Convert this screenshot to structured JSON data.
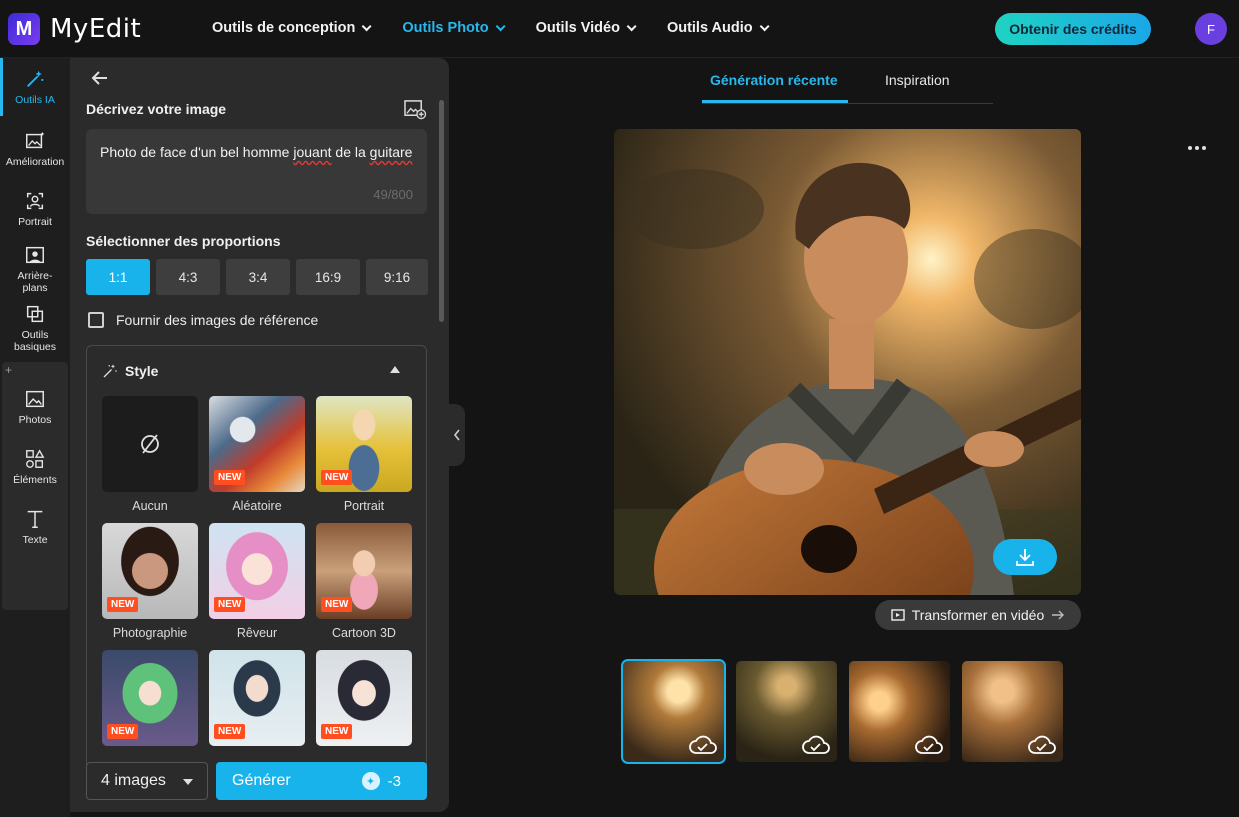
{
  "app": {
    "logo_letter": "M",
    "name": "MyEdit"
  },
  "nav": [
    {
      "label": "Outils de conception",
      "active": false
    },
    {
      "label": "Outils Photo",
      "active": true
    },
    {
      "label": "Outils Vidéo",
      "active": false
    },
    {
      "label": "Outils Audio",
      "active": false
    }
  ],
  "header": {
    "credits_button": "Obtenir des crédits",
    "avatar_initial": "F"
  },
  "rail": [
    {
      "label": "Outils IA",
      "icon": "magic-wand-icon",
      "active": true
    },
    {
      "label": "Amélioration",
      "icon": "image-enhance-icon"
    },
    {
      "label": "Portrait",
      "icon": "portrait-icon"
    },
    {
      "label": "Arrière-plans",
      "icon": "background-icon"
    },
    {
      "label": "Outils basiques",
      "icon": "crop-icon"
    },
    {
      "label": "Photos",
      "icon": "photo-icon"
    },
    {
      "label": "Éléments",
      "icon": "shapes-icon"
    },
    {
      "label": "Texte",
      "icon": "text-icon"
    }
  ],
  "panel": {
    "describe_title": "Décrivez votre image",
    "prompt_text_1": "Photo de face d'un bel homme ",
    "prompt_text_misspelled_1": "jouant",
    "prompt_text_2": " de la ",
    "prompt_text_misspelled_2": "guitare",
    "counter": "49/800",
    "ratio_title": "Sélectionner des proportions",
    "ratios": [
      "1:1",
      "4:3",
      "3:4",
      "16:9",
      "9:16"
    ],
    "selected_ratio": "1:1",
    "reference_label": "Fournir des images de référence",
    "reference_checked": false,
    "style_title": "Style",
    "styles": [
      {
        "label": "Aucun",
        "new": false
      },
      {
        "label": "Aléatoire",
        "new": true
      },
      {
        "label": "Portrait",
        "new": true
      },
      {
        "label": "Photographie",
        "new": true
      },
      {
        "label": "Rêveur",
        "new": true
      },
      {
        "label": "Cartoon 3D",
        "new": true
      },
      {
        "label": "",
        "new": true
      },
      {
        "label": "",
        "new": true
      },
      {
        "label": "",
        "new": true
      }
    ],
    "badge_text": "NEW",
    "image_count": "4 images",
    "generate_label": "Générer",
    "generate_cost": "-3"
  },
  "result": {
    "tabs": [
      "Génération récente",
      "Inspiration"
    ],
    "active_tab": "Génération récente",
    "video_button": "Transformer en vidéo",
    "thumbnails_count": 4,
    "selected_thumbnail": 0
  },
  "colors": {
    "accent": "#19b3ec",
    "badge": "#ff4e1f",
    "panel": "#2b2b2b"
  }
}
